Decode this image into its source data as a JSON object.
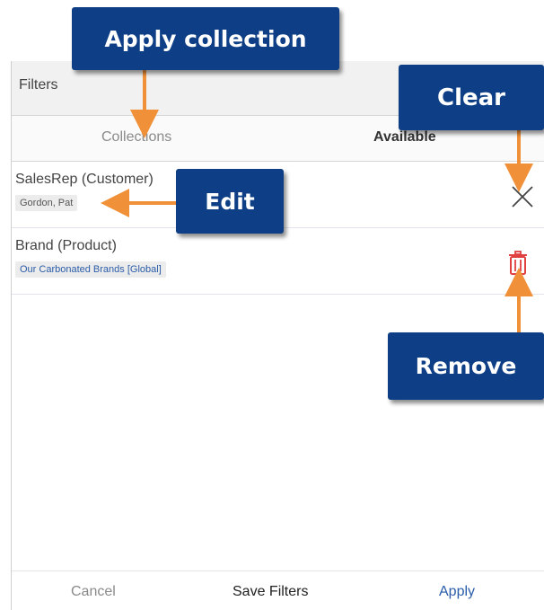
{
  "panel": {
    "header_title": "Filters",
    "tabs": [
      "Collections",
      "Available"
    ],
    "filters": [
      {
        "title": "SalesRep (Customer)",
        "chip": "Gordon, Pat",
        "action_icon": "close-icon"
      },
      {
        "title": "Brand (Product)",
        "chip": "Our Carbonated Brands [Global]",
        "action_icon": "trash-icon"
      }
    ],
    "footer": {
      "cancel": "Cancel",
      "save": "Save Filters",
      "apply": "Apply"
    }
  },
  "callouts": {
    "apply_collection": "Apply collection",
    "clear": "Clear",
    "edit": "Edit",
    "remove": "Remove"
  },
  "colors": {
    "callout_bg": "#0e3f86",
    "arrow": "#f0913a",
    "trash": "#e04040",
    "link_blue": "#2a5ca8"
  }
}
